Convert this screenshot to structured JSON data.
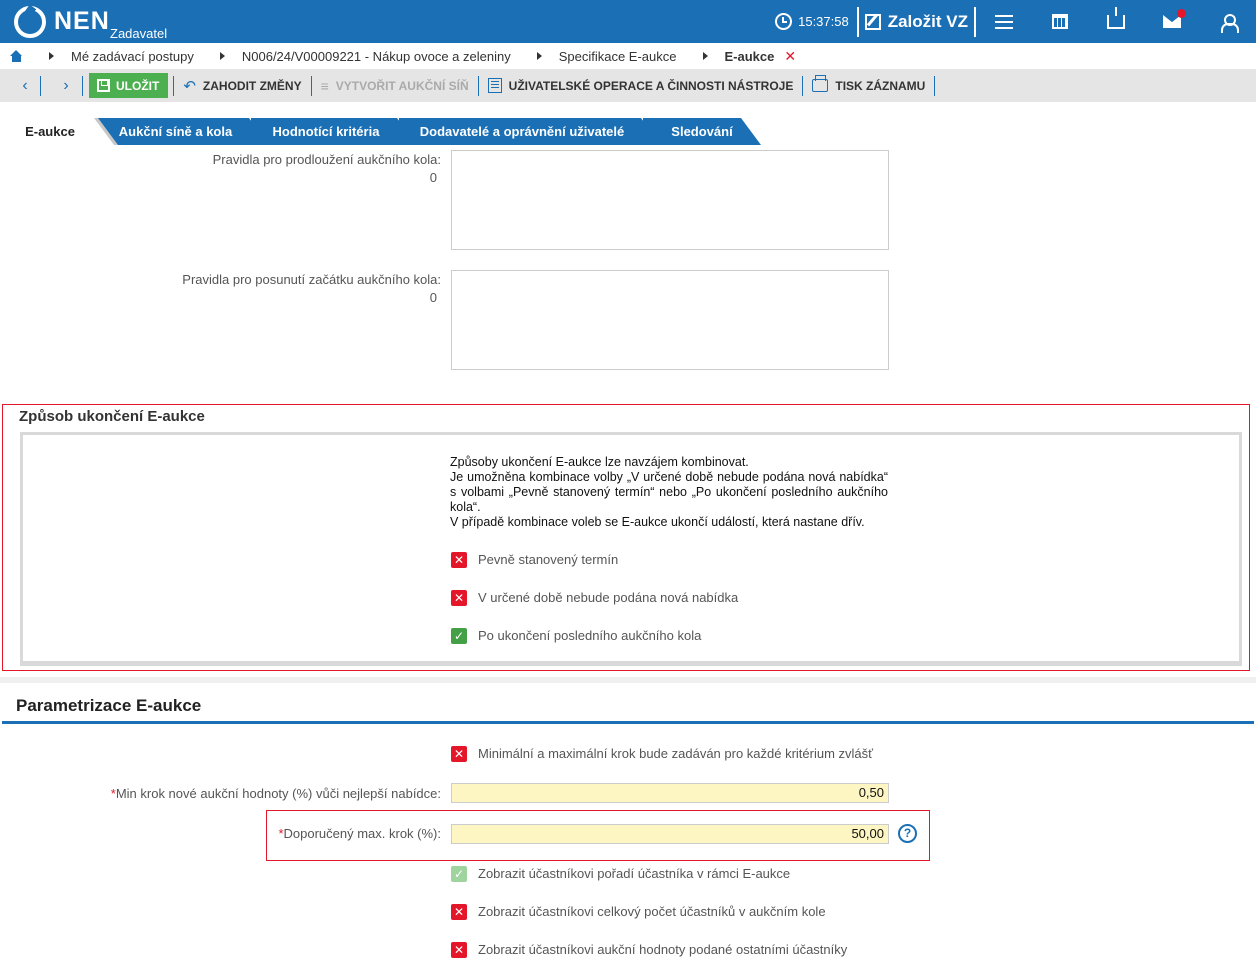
{
  "header": {
    "logo_text": "NEN",
    "role": "Zadavatel",
    "time": "15:37:58",
    "create_label": "Založit VZ"
  },
  "breadcrumb": {
    "items": [
      "Mé zadávací postupy",
      "N006/24/V00009221 - Nákup ovoce a zeleniny",
      "Specifikace E-aukce",
      "E-aukce"
    ]
  },
  "toolbar": {
    "save": "ULOŽIT",
    "discard": "ZAHODIT ZMĚNY",
    "create_hall": "VYTVOŘIT AUKČNÍ SÍŇ",
    "user_ops": "UŽIVATELSKÉ OPERACE A ČINNOSTI NÁSTROJE",
    "print": "TISK ZÁZNAMU"
  },
  "tabs": [
    "E-aukce",
    "Aukční síně a kola",
    "Hodnotící kritéria",
    "Dodavatelé a oprávnění uživatelé",
    "Sledování"
  ],
  "rules": {
    "extension_label": "Pravidla pro prodloužení aukčního kola:",
    "extension_count": "0",
    "shift_label": "Pravidla pro posunutí začátku aukčního kola:",
    "shift_count": "0"
  },
  "ending": {
    "title": "Způsob ukončení E-aukce",
    "info_line1": "Způsoby ukončení E-aukce lze navzájem kombinovat.",
    "info_line2": "Je umožněna kombinace volby „V určené době nebude podána nová nabídka“ s volbami „Pevně stanovený termín“ nebo „Po ukončení posledního aukčního kola“.",
    "info_line3": "V případě kombinace voleb se E-aukce ukončí událostí, která nastane dřív.",
    "options": [
      {
        "label": "Pevně stanovený termín",
        "checked": false
      },
      {
        "label": "V určené době nebude podána nová nabídka",
        "checked": false
      },
      {
        "label": "Po ukončení posledního aukčního kola",
        "checked": true
      }
    ]
  },
  "params": {
    "title": "Parametrizace E-aukce",
    "per_criterion_label": "Minimální a maximální krok bude zadáván pro každé kritérium zvlášť",
    "per_criterion_checked": false,
    "min_step_label": "Min krok nové aukční hodnoty (%) vůči nejlepší nabídce:",
    "min_step_value": "0,50",
    "max_step_label": "Doporučený max. krok (%):",
    "max_step_value": "50,00",
    "options": [
      {
        "label": "Zobrazit účastníkovi pořadí účastníka v rámci E-aukce",
        "checked": true
      },
      {
        "label": "Zobrazit účastníkovi celkový počet účastníků v aukčním kole",
        "checked": false
      },
      {
        "label": "Zobrazit účastníkovi aukční hodnoty podané ostatními účastníky",
        "checked": false
      }
    ]
  },
  "colors": {
    "brand": "#1a6fb5",
    "save_green": "#4caf50",
    "error_red": "#e3162a",
    "input_yellow": "#fdf6c3"
  }
}
